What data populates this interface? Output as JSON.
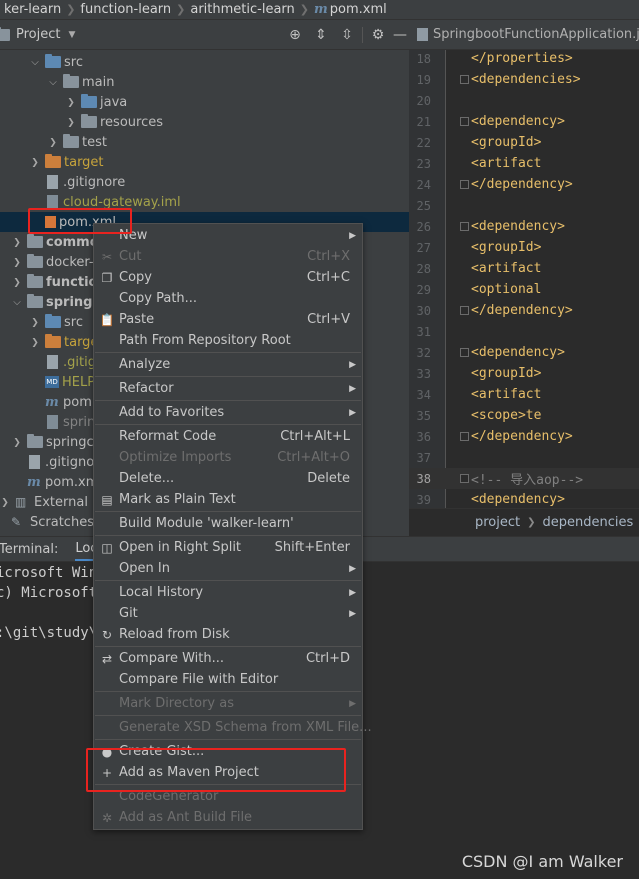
{
  "breadcrumb": [
    "ker-learn",
    "function-learn",
    "arithmetic-learn",
    "pom.xml"
  ],
  "project_panel": {
    "title": "Project",
    "tree": [
      {
        "label": "src",
        "type": "folder-src",
        "arrow": "open",
        "indent": 30
      },
      {
        "label": "main",
        "type": "folder",
        "arrow": "open",
        "indent": 48
      },
      {
        "label": "java",
        "type": "folder-src",
        "arrow": "closed",
        "indent": 66
      },
      {
        "label": "resources",
        "type": "folder",
        "arrow": "closed",
        "indent": 66
      },
      {
        "label": "test",
        "type": "folder",
        "arrow": "closed",
        "indent": 48
      },
      {
        "label": "target",
        "type": "folder-orange",
        "arrow": "closed",
        "indent": 30,
        "style": "orange"
      },
      {
        "label": ".gitignore",
        "type": "file",
        "arrow": "",
        "indent": 40
      },
      {
        "label": "cloud-gateway.iml",
        "type": "file-iml",
        "arrow": "",
        "indent": 40,
        "style": "ignored"
      },
      {
        "label": "pom.xml",
        "type": "file-pom-sel",
        "arrow": "",
        "indent": 40,
        "selected": true
      },
      {
        "label": "commo",
        "type": "folder",
        "arrow": "closed",
        "indent": 12,
        "style": "bold"
      },
      {
        "label": "docker-",
        "type": "folder",
        "arrow": "closed",
        "indent": 12
      },
      {
        "label": "functio",
        "type": "folder",
        "arrow": "closed",
        "indent": 12,
        "style": "bold"
      },
      {
        "label": "springb",
        "type": "folder",
        "arrow": "open",
        "indent": 12,
        "style": "bold"
      },
      {
        "label": "src",
        "type": "folder-src",
        "arrow": "closed",
        "indent": 30
      },
      {
        "label": "targe",
        "type": "folder-orange",
        "arrow": "closed",
        "indent": 30,
        "style": "orange"
      },
      {
        "label": ".gitig",
        "type": "file",
        "arrow": "",
        "indent": 40,
        "style": "ignored"
      },
      {
        "label": "HELP",
        "type": "file-md",
        "arrow": "",
        "indent": 40,
        "style": "ignored"
      },
      {
        "label": "pom",
        "type": "file-m",
        "arrow": "",
        "indent": 40
      },
      {
        "label": "sprin",
        "type": "file-iml",
        "arrow": "",
        "indent": 40,
        "style": "dim"
      },
      {
        "label": "springcl",
        "type": "folder",
        "arrow": "closed",
        "indent": 12
      },
      {
        "label": ".gitignor",
        "type": "file",
        "arrow": "",
        "indent": 22
      },
      {
        "label": "pom.xm",
        "type": "file-m",
        "arrow": "",
        "indent": 22
      },
      {
        "label": "External Lib",
        "type": "libs",
        "arrow": "closed",
        "indent": -2
      },
      {
        "label": "Scratches a",
        "type": "scratch",
        "arrow": "",
        "indent": 6
      }
    ]
  },
  "editor": {
    "tab_label": "SpringbootFunctionApplication.java",
    "lines": [
      {
        "n": "18",
        "code": "    </properties>"
      },
      {
        "n": "19",
        "code": "    <dependencies>"
      },
      {
        "n": "20",
        "code": ""
      },
      {
        "n": "21",
        "code": "        <dependency>"
      },
      {
        "n": "22",
        "code": "            <groupId>"
      },
      {
        "n": "23",
        "code": "            <artifact"
      },
      {
        "n": "24",
        "code": "        </dependency>"
      },
      {
        "n": "25",
        "code": ""
      },
      {
        "n": "26",
        "code": "        <dependency>"
      },
      {
        "n": "27",
        "code": "            <groupId>"
      },
      {
        "n": "28",
        "code": "            <artifact"
      },
      {
        "n": "29",
        "code": "            <optional"
      },
      {
        "n": "30",
        "code": "        </dependency>"
      },
      {
        "n": "31",
        "code": ""
      },
      {
        "n": "32",
        "code": "        <dependency>"
      },
      {
        "n": "33",
        "code": "            <groupId>"
      },
      {
        "n": "34",
        "code": "            <artifact"
      },
      {
        "n": "35",
        "code": "            <scope>te"
      },
      {
        "n": "36",
        "code": "        </dependency>"
      },
      {
        "n": "37",
        "code": ""
      },
      {
        "n": "38",
        "code": "<!--      导入aop-->",
        "comment": true,
        "current": true
      },
      {
        "n": "39",
        "code": "        <dependency>"
      }
    ],
    "status_crumbs": [
      "project",
      "dependencies"
    ]
  },
  "terminal": {
    "title": "Terminal:",
    "tab": "Local",
    "lines": [
      "icrosoft Win",
      "c) Microsoft",
      "",
      ":\\git\\study\\"
    ]
  },
  "context_menu": {
    "items": [
      {
        "label": "New",
        "shortcut": "",
        "submenu": true,
        "icon": ""
      },
      {
        "label": "Cut",
        "shortcut": "Ctrl+X",
        "disabled": true,
        "icon": "✂"
      },
      {
        "label": "Copy",
        "shortcut": "Ctrl+C",
        "icon": "❐"
      },
      {
        "label": "Copy Path...",
        "shortcut": "",
        "icon": ""
      },
      {
        "label": "Paste",
        "shortcut": "Ctrl+V",
        "icon": "📋"
      },
      {
        "label": "Path From Repository Root",
        "shortcut": "",
        "icon": ""
      },
      {
        "sep": true
      },
      {
        "label": "Analyze",
        "shortcut": "",
        "submenu": true,
        "icon": ""
      },
      {
        "sep": true
      },
      {
        "label": "Refactor",
        "shortcut": "",
        "submenu": true,
        "icon": ""
      },
      {
        "sep": true
      },
      {
        "label": "Add to Favorites",
        "shortcut": "",
        "submenu": true,
        "icon": ""
      },
      {
        "sep": true
      },
      {
        "label": "Reformat Code",
        "shortcut": "Ctrl+Alt+L",
        "icon": ""
      },
      {
        "label": "Optimize Imports",
        "shortcut": "Ctrl+Alt+O",
        "disabled": true,
        "icon": ""
      },
      {
        "label": "Delete...",
        "shortcut": "Delete",
        "icon": ""
      },
      {
        "label": "Mark as Plain Text",
        "shortcut": "",
        "icon": "▤"
      },
      {
        "sep": true
      },
      {
        "label": "Build Module 'walker-learn'",
        "shortcut": "",
        "icon": ""
      },
      {
        "sep": true
      },
      {
        "label": "Open in Right Split",
        "shortcut": "Shift+Enter",
        "icon": "◫"
      },
      {
        "label": "Open In",
        "shortcut": "",
        "submenu": true,
        "icon": ""
      },
      {
        "sep": true
      },
      {
        "label": "Local History",
        "shortcut": "",
        "submenu": true,
        "icon": ""
      },
      {
        "label": "Git",
        "shortcut": "",
        "submenu": true,
        "icon": ""
      },
      {
        "label": "Reload from Disk",
        "shortcut": "",
        "icon": "↻"
      },
      {
        "sep": true
      },
      {
        "label": "Compare With...",
        "shortcut": "Ctrl+D",
        "icon": "⇄"
      },
      {
        "label": "Compare File with Editor",
        "shortcut": "",
        "icon": ""
      },
      {
        "sep": true
      },
      {
        "label": "Mark Directory as",
        "shortcut": "",
        "submenu": true,
        "disabled": true,
        "icon": ""
      },
      {
        "sep": true
      },
      {
        "label": "Generate XSD Schema from XML File...",
        "shortcut": "",
        "disabled": true,
        "icon": ""
      },
      {
        "sep": true
      },
      {
        "label": "Create Gist...",
        "shortcut": "",
        "icon": "●"
      },
      {
        "label": "Add as Maven Project",
        "shortcut": "",
        "icon": "+"
      },
      {
        "sep": true
      },
      {
        "label": "CodeGenerator",
        "shortcut": "",
        "disabled": true,
        "icon": ""
      },
      {
        "label": "Add as Ant Build File",
        "shortcut": "",
        "disabled": true,
        "icon": "✲"
      }
    ]
  },
  "watermark": "CSDN @I am Walker",
  "colors": {
    "highlight_box": "#e8231f",
    "selection": "#0d293e",
    "panel": "#3c3f41",
    "editor_bg": "#2b2b2b"
  }
}
